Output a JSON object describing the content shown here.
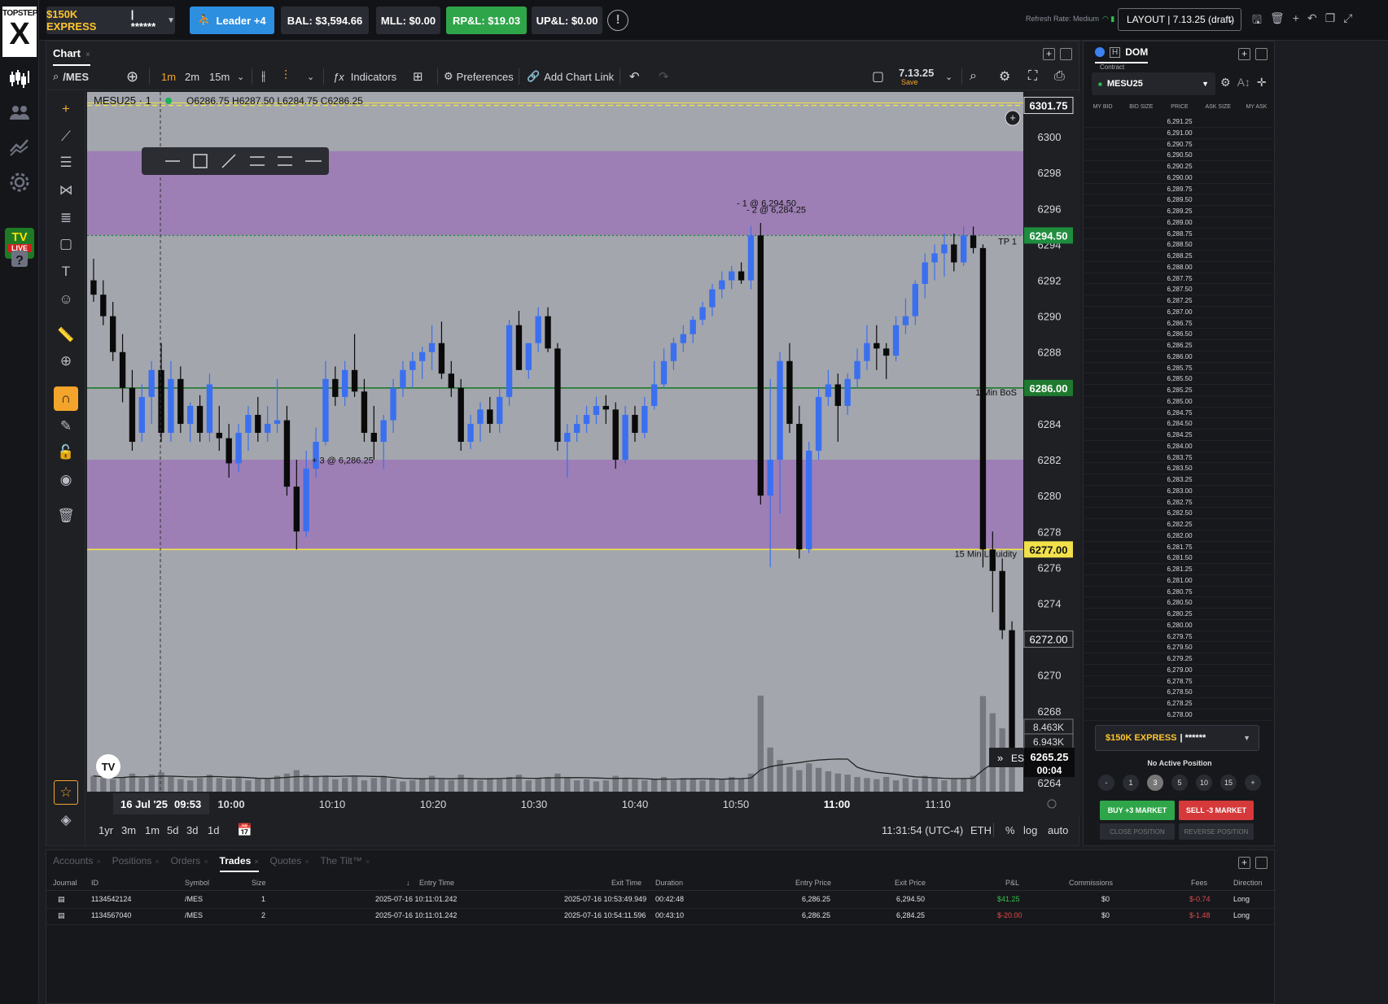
{
  "app": {
    "logo_top": "TOPSTEP",
    "logo_main": "X"
  },
  "topbar": {
    "account_name": "$150K EXPRESS",
    "account_masked": "| ******",
    "leader": "Leader +4",
    "balance": "BAL: $3,594.66",
    "mll": "MLL: $0.00",
    "rpl": "RP&L: $19.03",
    "upl": "UP&L: $0.00",
    "refresh_rate": "Refresh Rate: Medium",
    "layout": "LAYOUT | 7.13.25 (draft)"
  },
  "chart_panel": {
    "tab": "Chart",
    "symbol_search": "/MES",
    "timeframes": [
      "1m",
      "2m",
      "15m"
    ],
    "active_timeframe": "1m",
    "indicators_label": "Indicators",
    "preferences_label": "Preferences",
    "add_chart_link_label": "Add Chart Link",
    "layout_name": "7.13.25",
    "layout_sub": "Save",
    "legend_symbol": "MESU25 · 1",
    "legend_ohlc": "O6286.75  H6287.50  L6284.75  C6286.25",
    "range_buttons": [
      "1yr",
      "3m",
      "1m",
      "5d",
      "3d",
      "1d"
    ],
    "clock": "11:31:54 (UTC-4)",
    "session": "ETH",
    "scale_options": [
      "%",
      "log",
      "auto"
    ]
  },
  "chart_data": {
    "type": "candlestick",
    "symbol": "MESU25",
    "interval": "1m",
    "ylim": [
      6263.5,
      6302.5
    ],
    "y_ticks": [
      6264,
      6266,
      6268,
      6270,
      6272,
      6274,
      6276,
      6278,
      6280,
      6282,
      6284,
      6286,
      6288,
      6290,
      6292,
      6294,
      6296,
      6298,
      6300
    ],
    "x_ticks": [
      "10:00",
      "10:10",
      "10:20",
      "10:30",
      "10:40",
      "10:50",
      "11:00",
      "11:10"
    ],
    "cursor_date_label": "16 Jul '25",
    "cursor_time_label": "09:53",
    "zones": [
      {
        "from": 6294.5,
        "to": 6299.2,
        "color": "#9b72b8"
      },
      {
        "from": 6277.0,
        "to": 6282.0,
        "color": "#9b72b8"
      }
    ],
    "lines": [
      {
        "price": 6301.75,
        "label": "6301.75",
        "color": "#f2e14a",
        "style": "dashed",
        "tag_bg": "#1e2024"
      },
      {
        "price": 6294.5,
        "label": "6294.50",
        "color": "#1e8e3e",
        "style": "dotted",
        "tag_bg": "#1e8e3e",
        "text": "TP 1"
      },
      {
        "price": 6286.0,
        "label": "6286.00",
        "color": "#1e7a2e",
        "style": "solid",
        "tag_bg": "#1e7a2e",
        "text": "1 Min BoS"
      },
      {
        "price": 6277.0,
        "label": "6277.00",
        "color": "#f2e14a",
        "style": "solid",
        "tag_bg": "#f2e14a",
        "text": "15 Min Liquidity"
      }
    ],
    "price_tags": [
      {
        "label": "6272.00",
        "price": 6272.0
      }
    ],
    "last_price": {
      "value": "6265.25",
      "countdown": "00:04"
    },
    "volume_tags": [
      "8.463K",
      "6.943K"
    ],
    "trade_markers": [
      {
        "text": "+ 3 @ 6,286.25"
      },
      {
        "text": "- 1 @ 6,294.50"
      },
      {
        "text": "- 2 @ 6,284.25"
      }
    ],
    "candles": [
      [
        6292.0,
        6293.2,
        6290.8,
        6291.2
      ],
      [
        6291.2,
        6292.0,
        6289.5,
        6290.0
      ],
      [
        6290.0,
        6290.8,
        6287.5,
        6288.0
      ],
      [
        6288.0,
        6289.0,
        6285.2,
        6286.0
      ],
      [
        6286.0,
        6287.0,
        6282.5,
        6283.0
      ],
      [
        6283.5,
        6286.2,
        6283.0,
        6285.5
      ],
      [
        6285.5,
        6287.5,
        6284.0,
        6287.0
      ],
      [
        6287.0,
        6288.5,
        6283.0,
        6283.5
      ],
      [
        6283.5,
        6287.5,
        6283.0,
        6286.5
      ],
      [
        6286.5,
        6287.2,
        6283.5,
        6284.0
      ],
      [
        6284.0,
        6285.2,
        6283.0,
        6285.0
      ],
      [
        6285.0,
        6285.6,
        6283.0,
        6283.5
      ],
      [
        6283.5,
        6286.8,
        6283.0,
        6286.2
      ],
      [
        6283.5,
        6285.0,
        6282.5,
        6283.2
      ],
      [
        6283.2,
        6284.0,
        6281.0,
        6281.8
      ],
      [
        6281.8,
        6284.0,
        6281.3,
        6283.5
      ],
      [
        6283.5,
        6285.0,
        6282.5,
        6284.5
      ],
      [
        6284.5,
        6285.5,
        6283.0,
        6283.5
      ],
      [
        6283.5,
        6285.0,
        6283.0,
        6284.0
      ],
      [
        6284.0,
        6286.5,
        6283.5,
        6284.2
      ],
      [
        6284.2,
        6285.0,
        6280.0,
        6280.5
      ],
      [
        6280.5,
        6282.0,
        6277.0,
        6278.0
      ],
      [
        6278.0,
        6282.5,
        6277.7,
        6281.5
      ],
      [
        6281.5,
        6283.8,
        6281.0,
        6283.0
      ],
      [
        6283.0,
        6287.5,
        6282.8,
        6286.5
      ],
      [
        6286.5,
        6287.2,
        6285.0,
        6285.5
      ],
      [
        6285.5,
        6287.5,
        6285.0,
        6287.0
      ],
      [
        6287.0,
        6289.0,
        6285.5,
        6285.8
      ],
      [
        6285.8,
        6286.5,
        6283.0,
        6283.5
      ],
      [
        6283.5,
        6285.0,
        6282.0,
        6283.0
      ],
      [
        6283.0,
        6284.5,
        6281.5,
        6284.2
      ],
      [
        6284.2,
        6286.5,
        6283.5,
        6286.0
      ],
      [
        6286.0,
        6287.5,
        6285.5,
        6287.0
      ],
      [
        6287.0,
        6288.0,
        6286.0,
        6287.5
      ],
      [
        6287.5,
        6288.3,
        6286.5,
        6288.0
      ],
      [
        6288.0,
        6289.5,
        6287.0,
        6288.5
      ],
      [
        6288.5,
        6289.7,
        6286.5,
        6286.8
      ],
      [
        6286.8,
        6287.5,
        6285.5,
        6286.0
      ],
      [
        6286.0,
        6286.5,
        6282.5,
        6283.0
      ],
      [
        6283.0,
        6284.5,
        6282.6,
        6284.0
      ],
      [
        6284.0,
        6285.2,
        6283.0,
        6284.8
      ],
      [
        6284.8,
        6285.5,
        6283.5,
        6284.0
      ],
      [
        6284.0,
        6286.0,
        6283.5,
        6285.5
      ],
      [
        6285.5,
        6289.8,
        6285.0,
        6289.5
      ],
      [
        6289.5,
        6290.3,
        6287.0,
        6287.0
      ],
      [
        6287.0,
        6288.5,
        6286.5,
        6288.5
      ],
      [
        6288.5,
        6290.5,
        6288.0,
        6290.0
      ],
      [
        6290.0,
        6290.5,
        6288.0,
        6288.2
      ],
      [
        6288.2,
        6288.5,
        6282.5,
        6283.0
      ],
      [
        6283.0,
        6284.0,
        6281.0,
        6283.5
      ],
      [
        6283.5,
        6284.5,
        6283.0,
        6284.0
      ],
      [
        6284.0,
        6285.0,
        6283.5,
        6284.5
      ],
      [
        6284.5,
        6285.5,
        6284.0,
        6285.0
      ],
      [
        6285.0,
        6285.6,
        6284.0,
        6284.8
      ],
      [
        6284.8,
        6285.2,
        6281.5,
        6282.0
      ],
      [
        6282.0,
        6285.0,
        6281.8,
        6284.5
      ],
      [
        6284.5,
        6285.0,
        6283.0,
        6283.5
      ],
      [
        6283.5,
        6285.5,
        6283.2,
        6285.0
      ],
      [
        6285.0,
        6287.5,
        6284.8,
        6286.2
      ],
      [
        6286.2,
        6288.2,
        6286.0,
        6287.5
      ],
      [
        6287.5,
        6288.8,
        6287.0,
        6288.5
      ],
      [
        6288.5,
        6289.5,
        6288.0,
        6289.0
      ],
      [
        6289.0,
        6290.0,
        6288.5,
        6289.8
      ],
      [
        6289.8,
        6290.8,
        6289.5,
        6290.5
      ],
      [
        6290.5,
        6291.8,
        6290.0,
        6291.5
      ],
      [
        6291.5,
        6292.5,
        6291.0,
        6292.0
      ],
      [
        6292.0,
        6292.8,
        6291.5,
        6292.5
      ],
      [
        6292.5,
        6293.0,
        6291.8,
        6292.0
      ],
      [
        6292.0,
        6295.0,
        6291.5,
        6294.5
      ],
      [
        6294.5,
        6295.2,
        6279.5,
        6280.0
      ],
      [
        6280.0,
        6286.5,
        6276.0,
        6282.0
      ],
      [
        6282.0,
        6288.0,
        6279.0,
        6287.5
      ],
      [
        6287.5,
        6288.5,
        6283.5,
        6284.0
      ],
      [
        6284.0,
        6285.0,
        6276.5,
        6277.0
      ],
      [
        6277.0,
        6283.0,
        6276.8,
        6282.5
      ],
      [
        6282.5,
        6286.0,
        6282.0,
        6285.5
      ],
      [
        6285.5,
        6287.0,
        6285.0,
        6286.2
      ],
      [
        6286.2,
        6286.8,
        6283.0,
        6285.0
      ],
      [
        6285.0,
        6286.8,
        6284.5,
        6286.5
      ],
      [
        6286.5,
        6288.2,
        6286.0,
        6287.5
      ],
      [
        6287.5,
        6289.5,
        6287.0,
        6288.5
      ],
      [
        6288.5,
        6289.5,
        6287.0,
        6288.2
      ],
      [
        6288.2,
        6288.5,
        6286.5,
        6287.8
      ],
      [
        6287.8,
        6290.0,
        6287.5,
        6289.5
      ],
      [
        6289.5,
        6291.0,
        6289.0,
        6290.0
      ],
      [
        6290.0,
        6292.0,
        6289.5,
        6291.8
      ],
      [
        6291.8,
        6293.5,
        6291.0,
        6293.0
      ],
      [
        6293.0,
        6294.0,
        6292.0,
        6293.5
      ],
      [
        6293.5,
        6294.6,
        6292.2,
        6294.0
      ],
      [
        6294.0,
        6294.6,
        6292.5,
        6293.0
      ],
      [
        6293.0,
        6295.0,
        6292.8,
        6294.5
      ],
      [
        6294.5,
        6295.0,
        6293.5,
        6293.8
      ],
      [
        6293.8,
        6294.0,
        6276.0,
        6277.0
      ],
      [
        6277.0,
        6278.0,
        6273.5,
        6275.8
      ],
      [
        6275.8,
        6276.5,
        6272.0,
        6272.5
      ],
      [
        6272.5,
        6273.0,
        6265.0,
        6265.25
      ]
    ],
    "volumes": [
      1.4,
      1.2,
      1.1,
      1.3,
      1.6,
      1.2,
      1.5,
      1.7,
      1.3,
      1.1,
      1.0,
      1.2,
      1.5,
      1.2,
      1.1,
      1.3,
      1.0,
      1.2,
      1.1,
      1.4,
      1.6,
      1.9,
      1.5,
      1.3,
      1.4,
      1.1,
      1.2,
      1.3,
      1.0,
      1.2,
      1.4,
      1.1,
      0.9,
      1.0,
      1.2,
      1.4,
      1.1,
      1.0,
      1.5,
      1.1,
      1.0,
      1.2,
      1.1,
      1.3,
      1.5,
      1.0,
      1.2,
      1.3,
      1.6,
      1.2,
      1.0,
      1.1,
      0.9,
      1.0,
      1.4,
      1.2,
      1.1,
      1.0,
      1.1,
      1.3,
      1.0,
      1.2,
      1.1,
      1.0,
      1.2,
      1.1,
      1.3,
      1.2,
      1.6,
      8.5,
      3.9,
      2.8,
      2.2,
      1.9,
      2.5,
      2.1,
      1.8,
      1.6,
      1.5,
      1.3,
      1.2,
      1.1,
      1.3,
      1.0,
      1.2,
      1.1,
      1.4,
      1.2,
      1.0,
      1.1,
      1.2,
      1.4,
      8.46,
      6.94,
      5.6,
      2.3
    ]
  },
  "dom": {
    "tab": "DOM",
    "tab_h": "H",
    "contract_label": "Contract",
    "contract": "MESU25",
    "headers": [
      "MY BID",
      "BID SIZE",
      "PRICE",
      "ASK SIZE",
      "MY ASK"
    ],
    "prices": [
      "6,291.25",
      "6,291.00",
      "6,290.75",
      "6,290.50",
      "6,290.25",
      "6,290.00",
      "6,289.75",
      "6,289.50",
      "6,289.25",
      "6,289.00",
      "6,288.75",
      "6,288.50",
      "6,288.25",
      "6,288.00",
      "6,287.75",
      "6,287.50",
      "6,287.25",
      "6,287.00",
      "6,286.75",
      "6,286.50",
      "6,286.25",
      "6,286.00",
      "6,285.75",
      "6,285.50",
      "6,285.25",
      "6,285.00",
      "6,284.75",
      "6,284.50",
      "6,284.25",
      "6,284.00",
      "6,283.75",
      "6,283.50",
      "6,283.25",
      "6,283.00",
      "6,282.75",
      "6,282.50",
      "6,282.25",
      "6,282.00",
      "6,281.75",
      "6,281.50",
      "6,281.25",
      "6,281.00",
      "6,280.75",
      "6,280.50",
      "6,280.25",
      "6,280.00",
      "6,279.75",
      "6,279.50",
      "6,279.25",
      "6,279.00",
      "6,278.75",
      "6,278.50",
      "6,278.25",
      "6,278.00"
    ],
    "account_name": "$150K EXPRESS",
    "account_masked": "| ******",
    "position_status": "No Active Position",
    "quantities": [
      "-",
      "1",
      "3",
      "5",
      "10",
      "15",
      "+"
    ],
    "selected_qty": "3",
    "buy_label": "BUY +3 MARKET",
    "sell_label": "SELL -3 MARKET",
    "close_label": "CLOSE POSITION",
    "reverse_label": "REVERSE POSITION"
  },
  "bottom": {
    "tabs": [
      "Accounts",
      "Positions",
      "Orders",
      "Trades",
      "Quotes",
      "The Tilt™"
    ],
    "active_tab": "Trades",
    "headers": [
      "Journal",
      "ID",
      "Symbol",
      "Size",
      "Entry Time",
      "Exit Time",
      "Duration",
      "Entry Price",
      "Exit Price",
      "P&L",
      "Commissions",
      "Fees",
      "Direction"
    ],
    "rows": [
      {
        "id": "1134542124",
        "symbol": "/MES",
        "size": "1",
        "entry_time": "2025-07-16 10:11:01.242",
        "exit_time": "2025-07-16 10:53:49.949",
        "duration": "00:42:48",
        "entry_price": "6,286.25",
        "exit_price": "6,294.50",
        "pnl": "$41.25",
        "commissions": "$0",
        "fees": "$-0.74",
        "direction": "Long"
      },
      {
        "id": "1134567040",
        "symbol": "/MES",
        "size": "2",
        "entry_time": "2025-07-16 10:11:01.242",
        "exit_time": "2025-07-16 10:54:11.596",
        "duration": "00:43:10",
        "entry_price": "6,286.25",
        "exit_price": "6,284.25",
        "pnl": "$-20.00",
        "commissions": "$0",
        "fees": "$-1.48",
        "direction": "Long"
      }
    ]
  },
  "colors": {
    "up": "#3a6ff0",
    "down": "#0a0a0a",
    "chart_bg": "#a3a6ad",
    "zone": "#9b72b8",
    "accent": "#f4a42a",
    "buy": "#2fa549",
    "sell": "#d5393a"
  }
}
